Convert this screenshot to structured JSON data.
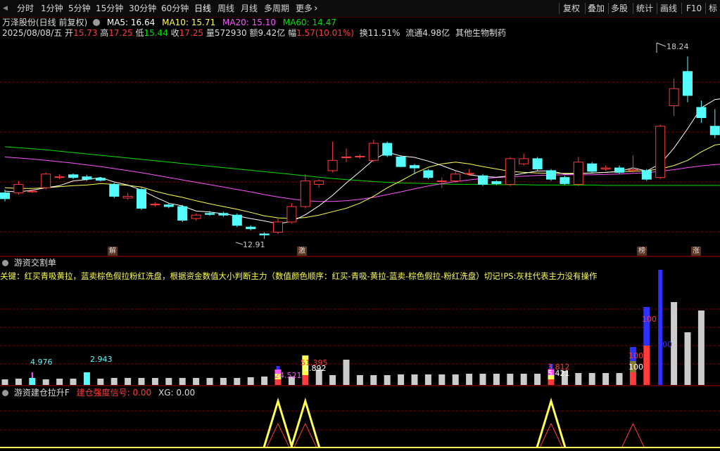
{
  "colors": {
    "up": "#ff3b3b",
    "down": "#54fcfc",
    "ma5": "#ffffff",
    "ma10": "#ffff54",
    "ma20": "#ff54ff",
    "ma60": "#00e000",
    "grid": "#7a0000",
    "bg": "#000000"
  },
  "toolbar": {
    "back_icon": "◀",
    "periods": [
      "分时",
      "1分钟",
      "5分钟",
      "15分钟",
      "30分钟",
      "60分钟",
      "日线",
      "周线",
      "月线",
      "多周期",
      "更多"
    ],
    "more_arrow": "›",
    "right": [
      "复权",
      "叠加",
      "多股",
      "统计",
      "画线",
      "F10",
      "标"
    ]
  },
  "stock": {
    "name": "万泽股份(日线 前复权)",
    "ma5_label": "MA5: 16.64",
    "ma10_label": "MA10: 15.71",
    "ma20_label": "MA20: 15.10",
    "ma60_label": "MA60: 14.47",
    "date": "2025/08/08/五",
    "open_label": "开",
    "open": "15.73",
    "high_label": "高",
    "high": "17.25",
    "low_label": "低",
    "low": "15.44",
    "close_label": "收",
    "close": "17.25",
    "vol_label": "量",
    "vol": "572930",
    "amt_label": "额",
    "amt": "9.42亿",
    "chg_label": "幅",
    "chg": "1.57(10.01%)",
    "turnover": "换11.51%",
    "float": "流通4.98亿",
    "sector": "其他生物制药"
  },
  "price_chart": {
    "high_label": "18.24",
    "low_label": "12.91",
    "markers": [
      "解",
      "激",
      "榜",
      "涨"
    ]
  },
  "panel2": {
    "title": "游资交割单",
    "desc": "关键：红买青吸黄拉，蓝卖棕色假拉粉红洗盘，根据资金数值大小判断主力（数值颜色顺序：红买-青吸-黄拉-蓝卖-棕色假拉-粉红洗盘）切记!PS:灰柱代表主力没有操作",
    "labels": [
      "4.976",
      "2.943",
      "24.521",
      "51.395",
      "2.892",
      "3.812",
      "5.421",
      "100",
      "100",
      "100",
      "100"
    ]
  },
  "panel3": {
    "title": "游资建仓拉升F",
    "signal_label": "建仓强度信号:",
    "signal_value": "0.00",
    "xg_label": "XG:",
    "xg_value": "0.00"
  },
  "chart_data": {
    "type": "candlestick",
    "candles": [
      {
        "o": 14.25,
        "c": 14.08,
        "h": 14.35,
        "l": 14.0
      },
      {
        "o": 14.25,
        "c": 14.5,
        "h": 14.6,
        "l": 14.2
      },
      {
        "o": 14.3,
        "c": 14.3,
        "h": 14.35,
        "l": 14.25
      },
      {
        "o": 14.4,
        "c": 14.8,
        "h": 14.85,
        "l": 14.35
      },
      {
        "o": 14.7,
        "c": 14.72,
        "h": 14.8,
        "l": 14.65
      },
      {
        "o": 14.78,
        "c": 14.7,
        "h": 14.82,
        "l": 14.65
      },
      {
        "o": 14.72,
        "c": 14.65,
        "h": 14.78,
        "l": 14.6
      },
      {
        "o": 14.68,
        "c": 14.62,
        "h": 14.72,
        "l": 14.58
      },
      {
        "o": 14.5,
        "c": 14.15,
        "h": 14.55,
        "l": 14.1
      },
      {
        "o": 14.1,
        "c": 14.15,
        "h": 14.25,
        "l": 14.05
      },
      {
        "o": 14.35,
        "c": 13.8,
        "h": 14.4,
        "l": 13.75
      },
      {
        "o": 13.9,
        "c": 13.92,
        "h": 13.98,
        "l": 13.85
      },
      {
        "o": 13.9,
        "c": 13.85,
        "h": 13.95,
        "l": 13.8
      },
      {
        "o": 13.85,
        "c": 13.45,
        "h": 13.9,
        "l": 13.4
      },
      {
        "o": 13.5,
        "c": 13.6,
        "h": 13.65,
        "l": 13.45
      },
      {
        "o": 13.65,
        "c": 13.62,
        "h": 13.72,
        "l": 13.58
      },
      {
        "o": 13.65,
        "c": 13.6,
        "h": 13.7,
        "l": 13.55
      },
      {
        "o": 13.6,
        "c": 13.3,
        "h": 13.65,
        "l": 13.25
      },
      {
        "o": 13.25,
        "c": 13.2,
        "h": 13.3,
        "l": 13.15
      },
      {
        "o": 13.05,
        "c": 13.02,
        "h": 13.1,
        "l": 12.91
      },
      {
        "o": 13.1,
        "c": 13.4,
        "h": 13.5,
        "l": 13.05
      },
      {
        "o": 13.4,
        "c": 13.85,
        "h": 13.95,
        "l": 13.35
      },
      {
        "o": 13.85,
        "c": 14.6,
        "h": 14.8,
        "l": 13.8
      },
      {
        "o": 14.5,
        "c": 14.6,
        "h": 14.65,
        "l": 14.4
      },
      {
        "o": 14.9,
        "c": 15.2,
        "h": 15.75,
        "l": 14.85
      },
      {
        "o": 15.3,
        "c": 15.3,
        "h": 15.55,
        "l": 15.15
      },
      {
        "o": 15.3,
        "c": 15.32,
        "h": 15.38,
        "l": 15.25
      },
      {
        "o": 15.2,
        "c": 15.7,
        "h": 15.8,
        "l": 15.15
      },
      {
        "o": 15.7,
        "c": 15.35,
        "h": 15.75,
        "l": 15.3
      },
      {
        "o": 15.3,
        "c": 15.02,
        "h": 15.35,
        "l": 15.0
      },
      {
        "o": 15.05,
        "c": 14.98,
        "h": 15.1,
        "l": 14.8
      },
      {
        "o": 14.9,
        "c": 14.7,
        "h": 14.95,
        "l": 14.65
      },
      {
        "o": 14.6,
        "c": 14.6,
        "h": 14.7,
        "l": 14.4
      },
      {
        "o": 14.6,
        "c": 14.8,
        "h": 14.9,
        "l": 14.55
      },
      {
        "o": 14.8,
        "c": 14.82,
        "h": 14.95,
        "l": 14.75
      },
      {
        "o": 14.75,
        "c": 14.5,
        "h": 14.8,
        "l": 14.45
      },
      {
        "o": 14.58,
        "c": 14.52,
        "h": 14.62,
        "l": 14.48
      },
      {
        "o": 14.5,
        "c": 15.25,
        "h": 15.3,
        "l": 14.45
      },
      {
        "o": 15.1,
        "c": 15.25,
        "h": 15.4,
        "l": 15.05
      },
      {
        "o": 15.25,
        "c": 14.95,
        "h": 15.3,
        "l": 14.9
      },
      {
        "o": 14.9,
        "c": 14.65,
        "h": 14.95,
        "l": 14.6
      },
      {
        "o": 14.7,
        "c": 14.52,
        "h": 14.75,
        "l": 14.48
      },
      {
        "o": 14.5,
        "c": 15.15,
        "h": 15.3,
        "l": 14.45
      },
      {
        "o": 15.1,
        "c": 14.88,
        "h": 15.15,
        "l": 14.85
      },
      {
        "o": 14.95,
        "c": 14.98,
        "h": 15.05,
        "l": 14.9
      },
      {
        "o": 14.98,
        "c": 14.85,
        "h": 15.05,
        "l": 14.8
      },
      {
        "o": 14.9,
        "c": 14.93,
        "h": 15.35,
        "l": 14.85
      },
      {
        "o": 14.9,
        "c": 14.65,
        "h": 14.95,
        "l": 14.6
      },
      {
        "o": 14.7,
        "c": 16.2,
        "h": 16.25,
        "l": 14.65
      },
      {
        "o": 16.8,
        "c": 17.3,
        "h": 17.6,
        "l": 16.5
      },
      {
        "o": 17.8,
        "c": 17.1,
        "h": 18.24,
        "l": 16.9
      },
      {
        "o": 16.75,
        "c": 16.45,
        "h": 16.95,
        "l": 16.3
      },
      {
        "o": 16.2,
        "c": 15.95,
        "h": 16.7,
        "l": 15.85
      },
      {
        "o": 15.73,
        "c": 17.25,
        "h": 17.25,
        "l": 15.44
      }
    ],
    "ma5": [
      14.3,
      14.28,
      14.33,
      14.4,
      14.46,
      14.6,
      14.64,
      14.7,
      14.57,
      14.48,
      14.33,
      14.13,
      13.95,
      13.87,
      13.72,
      13.69,
      13.64,
      13.58,
      13.5,
      13.43,
      13.35,
      13.41,
      13.61,
      13.87,
      14.18,
      14.54,
      14.87,
      15.22,
      15.44,
      15.33,
      15.29,
      15.18,
      15.05,
      14.9,
      14.78,
      14.73,
      14.71,
      14.75,
      14.82,
      14.89,
      14.89,
      14.8,
      14.81,
      14.83,
      14.85,
      14.88,
      14.98,
      14.89,
      15.1,
      15.56,
      16.13,
      16.74,
      16.98,
      17.03
    ],
    "ma10": [
      14.4,
      14.38,
      14.38,
      14.4,
      14.43,
      14.46,
      14.48,
      14.52,
      14.5,
      14.47,
      14.42,
      14.3,
      14.2,
      14.12,
      14.02,
      13.93,
      13.85,
      13.77,
      13.68,
      13.58,
      13.52,
      13.5,
      13.53,
      13.6,
      13.7,
      13.8,
      13.95,
      14.15,
      14.4,
      14.6,
      14.82,
      15.0,
      15.1,
      15.15,
      15.1,
      15.02,
      14.95,
      14.88,
      14.85,
      14.83,
      14.82,
      14.82,
      14.82,
      14.83,
      14.85,
      14.87,
      14.88,
      14.9,
      14.95,
      15.05,
      15.2,
      15.45,
      15.65,
      15.71
    ],
    "ma20": [
      15.3,
      15.27,
      15.24,
      15.2,
      15.16,
      15.12,
      15.07,
      15.02,
      14.96,
      14.9,
      14.84,
      14.77,
      14.7,
      14.63,
      14.56,
      14.49,
      14.42,
      14.35,
      14.28,
      14.2,
      14.13,
      14.07,
      14.02,
      14.0,
      14.0,
      14.02,
      14.06,
      14.12,
      14.2,
      14.28,
      14.37,
      14.45,
      14.52,
      14.58,
      14.63,
      14.67,
      14.7,
      14.72,
      14.74,
      14.76,
      14.77,
      14.78,
      14.78,
      14.78,
      14.79,
      14.8,
      14.82,
      14.84,
      14.88,
      14.93,
      14.99,
      15.04,
      15.08,
      15.1
    ],
    "ma60": [
      15.6,
      15.57,
      15.54,
      15.51,
      15.47,
      15.43,
      15.39,
      15.35,
      15.31,
      15.27,
      15.23,
      15.19,
      15.15,
      15.11,
      15.07,
      15.03,
      14.99,
      14.95,
      14.91,
      14.87,
      14.83,
      14.79,
      14.75,
      14.71,
      14.67,
      14.64,
      14.61,
      14.58,
      14.56,
      14.54,
      14.53,
      14.52,
      14.51,
      14.5,
      14.5,
      14.5,
      14.49,
      14.49,
      14.49,
      14.48,
      14.48,
      14.48,
      14.48,
      14.48,
      14.47,
      14.47,
      14.47,
      14.47,
      14.47,
      14.47,
      14.47,
      14.47,
      14.47,
      14.47
    ],
    "ylim": [
      12.7,
      18.7
    ]
  }
}
